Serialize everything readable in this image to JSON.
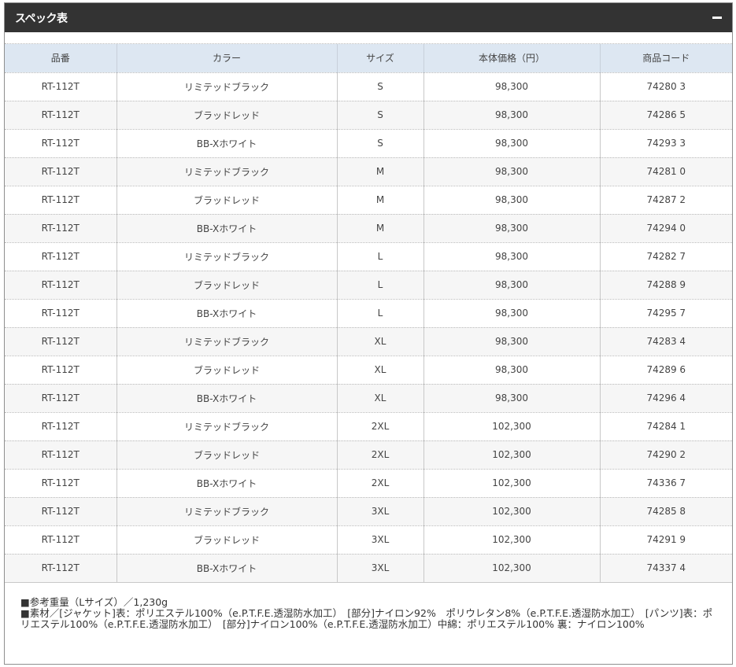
{
  "panel": {
    "title": "スペック表"
  },
  "table": {
    "headers": [
      "品番",
      "カラー",
      "サイズ",
      "本体価格（円）",
      "商品コード"
    ],
    "rows": [
      [
        "RT-112T",
        "リミテッドブラック",
        "S",
        "98,300",
        "74280 3"
      ],
      [
        "RT-112T",
        "ブラッドレッド",
        "S",
        "98,300",
        "74286 5"
      ],
      [
        "RT-112T",
        "BB-Xホワイト",
        "S",
        "98,300",
        "74293 3"
      ],
      [
        "RT-112T",
        "リミテッドブラック",
        "M",
        "98,300",
        "74281 0"
      ],
      [
        "RT-112T",
        "ブラッドレッド",
        "M",
        "98,300",
        "74287 2"
      ],
      [
        "RT-112T",
        "BB-Xホワイト",
        "M",
        "98,300",
        "74294 0"
      ],
      [
        "RT-112T",
        "リミテッドブラック",
        "L",
        "98,300",
        "74282 7"
      ],
      [
        "RT-112T",
        "ブラッドレッド",
        "L",
        "98,300",
        "74288 9"
      ],
      [
        "RT-112T",
        "BB-Xホワイト",
        "L",
        "98,300",
        "74295 7"
      ],
      [
        "RT-112T",
        "リミテッドブラック",
        "XL",
        "98,300",
        "74283 4"
      ],
      [
        "RT-112T",
        "ブラッドレッド",
        "XL",
        "98,300",
        "74289 6"
      ],
      [
        "RT-112T",
        "BB-Xホワイト",
        "XL",
        "98,300",
        "74296 4"
      ],
      [
        "RT-112T",
        "リミテッドブラック",
        "2XL",
        "102,300",
        "74284 1"
      ],
      [
        "RT-112T",
        "ブラッドレッド",
        "2XL",
        "102,300",
        "74290 2"
      ],
      [
        "RT-112T",
        "BB-Xホワイト",
        "2XL",
        "102,300",
        "74336 7"
      ],
      [
        "RT-112T",
        "リミテッドブラック",
        "3XL",
        "102,300",
        "74285 8"
      ],
      [
        "RT-112T",
        "ブラッドレッド",
        "3XL",
        "102,300",
        "74291 9"
      ],
      [
        "RT-112T",
        "BB-Xホワイト",
        "3XL",
        "102,300",
        "74337 4"
      ]
    ]
  },
  "notes": [
    "■参考重量（Lサイズ）／1,230g",
    "■素材／[ジャケット]表：ポリエステル100%（e.P.T.F.E.透湿防水加工）　[部分]ナイロン92%　ポリウレタン8%（e.P.T.F.E.透湿防水加工）　[パンツ]表：ポリエステル100%（e.P.T.F.E.透湿防水加工）　[部分]ナイロン100%（e.P.T.F.E.透湿防水加工）中綿：ポリエステル100% 裏：ナイロン100%"
  ],
  "colors": {
    "header_bar": "#333333",
    "table_header_bg": "#dde7f2",
    "zebra_row_bg": "#f6f6f6"
  },
  "icons": {
    "collapse": "minus-icon"
  }
}
